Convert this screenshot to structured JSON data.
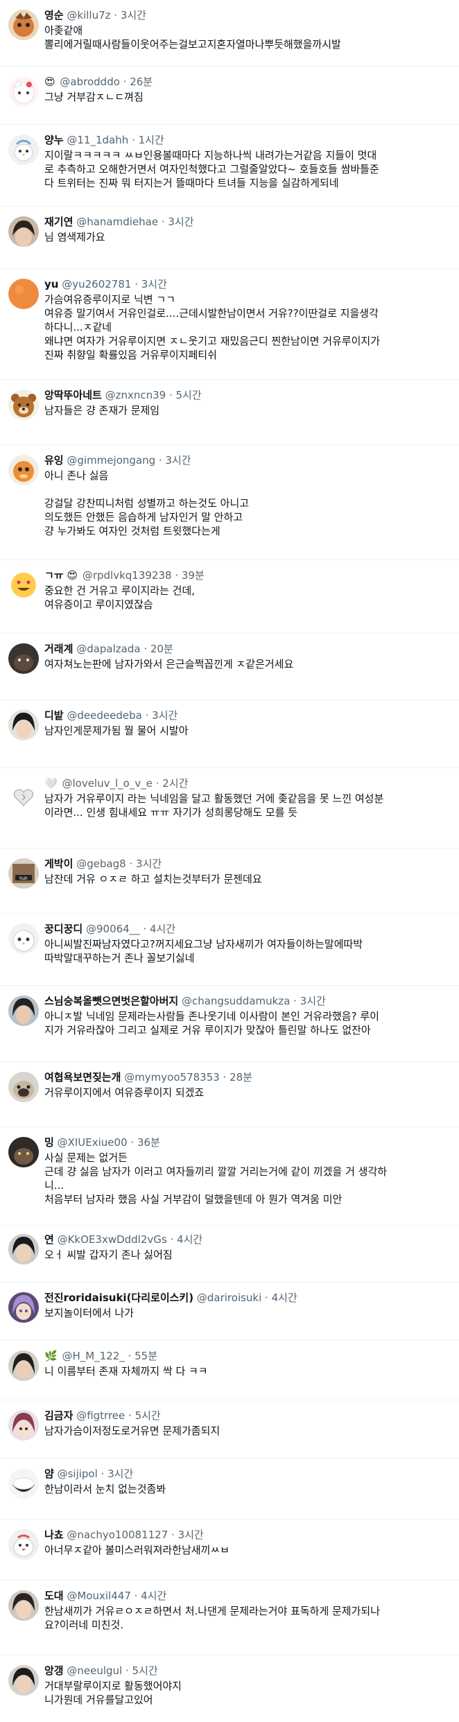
{
  "replies": [
    {
      "name": "영순",
      "handle": "@killu7z",
      "time": "3시간",
      "lines": [
        "아좆같애",
        "뽈리에거릴때사람들이웃어주는걸보고지혼자열마나뿌듯해했을까시발"
      ],
      "avatar": "orange-character"
    },
    {
      "name": "",
      "handle": "@abrodddo",
      "time": "26분",
      "name_emoji": "😍",
      "lines": [
        "그냥 거부감ㅈㄴㄷ껴짐"
      ],
      "avatar": "cat-character"
    },
    {
      "name": "양누",
      "handle": "@11_1dahh",
      "time": "1시간",
      "lines": [
        "지이랄ㅋㅋㅋㅋㅋ ㅆㅂ인용볼때마다 지능하나씩 내려가는거같음 지들이 멋대",
        "로 추측하고 오해한거면서 여자인척했다고 그럴줄알았다~ 호들호들 쌈바틀준",
        "다 트위터는 진짜 뭐 터지는거 뜰때마다 트녀들 지능을 실감하게되네"
      ],
      "avatar": "bird-character"
    },
    {
      "name": "재기연",
      "handle": "@hanamdiehae",
      "time": "3시간",
      "lines": [
        "님 염색제가요"
      ],
      "avatar": "dark-hair-person"
    },
    {
      "name": "yu",
      "handle": "@yu2602781",
      "time": "3시간",
      "lines": [
        "가슴여유증루이지로 닉변 ㄱㄱ",
        "여유증 말기여서 거유인걸로....근데시발한남이면서 거유??이딴걸로 지을생각",
        "하다니...ㅈ같네",
        "왜냐면 여자가 거유루이지면 ㅈㄴ웃기고 재밌음근디 찐한남이면 거유루이지가",
        "진짜 취향일 확률있음 거유루이지페티쉬"
      ],
      "avatar": "orange-circle"
    },
    {
      "name": "앙딱뚜아네트",
      "handle": "@znxncn39",
      "time": "5시간",
      "lines": [
        "남자들은 걍 존재가 문제임"
      ],
      "avatar": "bear-character"
    },
    {
      "name": "유잉",
      "handle": "@gimmejongang",
      "time": "3시간",
      "lines": [
        "아니 존나 싫음",
        "",
        "강걸달 강찬띠니처럼 성별까고 하는것도 아니고",
        "의도했든 안했든 음습하게 남자인거 말 안하고",
        "걍 누가봐도 여자인 것처럼 트윗했다는게"
      ],
      "avatar": "charmander-character"
    },
    {
      "name": "ㄱㅠ",
      "handle": "@rpdlvkq139238",
      "time": "39분",
      "name_emoji": "😍",
      "lines": [
        "중요한 건 거유고 루이지라는 건데,",
        "여유증이고 루이지였잖슴"
      ],
      "avatar": "smile-emoji"
    },
    {
      "name": "거래계",
      "handle": "@dapalzada",
      "time": "20분",
      "lines": [
        "여자쳐노는판에 남자가와서 은근슬쩍꼽낀게 ㅈ같은거세요"
      ],
      "avatar": "dark-animal"
    },
    {
      "name": "디밭",
      "handle": "@deedeedeba",
      "time": "3시간",
      "lines": [
        "남자인게문제가됨 뭘 물어 시발아"
      ],
      "avatar": "dark-hair-person"
    },
    {
      "name": "",
      "handle": "@loveluv_l_o_v_e",
      "time": "2시간",
      "name_emoji": "🤍",
      "lines": [
        "남자가 거유루이지 라는 닉네임을 달고 활동했던 거에 좆같음을 못 느낀 여성분",
        "이라면... 인생 힘내세요 ㅠㅠ 자기가 성희롱당해도 모를 듯"
      ],
      "avatar": "white-heart"
    },
    {
      "name": "게박이",
      "handle": "@gebag8",
      "time": "3시간",
      "lines": [
        "남잔데 거유 ㅇㅈㄹ 하고 설치는것부터가 문젠데요"
      ],
      "avatar": "meme-image"
    },
    {
      "name": "꿍디꿍디",
      "handle": "@90064__",
      "time": "4시간",
      "lines": [
        "아니씨발진짜남자였다고?꺼지세요그냥 남자새끼가 여자들이하는말에따박",
        "따박말대꾸하는거 존나 꼴보기싫네"
      ],
      "avatar": "white-cat"
    },
    {
      "name": "스님숭복올뺏으면벗은할아버지",
      "handle": "@changsuddamukza",
      "time": "3시간",
      "lines": [
        "아니ㅈ발 닉네임 문제라는사람들 존나웃기네 이사람이 본인 거유라했음? 루이",
        "지가 거유라잖아 그리고 실제로 거유 루이지가 맞잖아 틀린말 하나도 없잔아"
      ],
      "avatar": "dark-hair-person"
    },
    {
      "name": "여협욕보면짖는개",
      "handle": "@mymyoo578353",
      "time": "28분",
      "lines": [
        "거유루이지에서 여유증루이지 되겠죠"
      ],
      "avatar": "pug-dog"
    },
    {
      "name": "밍",
      "handle": "@XIUExiue00",
      "time": "36분",
      "lines": [
        "사실 문제는 없거든",
        "근데 걍 싫음 남자가 이러고 여자들끼리 깔깔 거리는거에 같이 끼겠을 거 생각하",
        "니...",
        "처음부터 남자라 했음 사실 거부감이 덜했을텐데 아 뭔가 역겨움 미안"
      ],
      "avatar": "dark-animal"
    },
    {
      "name": "연",
      "handle": "@KkOE3xwDddl2vGs",
      "time": "4시간",
      "lines": [
        "오ㅓ 씨발 갑자기 존나 싫어짐"
      ],
      "avatar": "dark-hair-person"
    },
    {
      "name": "전진roridaisuki(다리로이스키)",
      "handle": "@dariroisuki",
      "time": "4시간",
      "lines": [
        "보지놀이터에서 나가"
      ],
      "avatar": "purple-anime"
    },
    {
      "name": "",
      "handle": "@H_M_122_",
      "time": "55분",
      "name_emoji": "🌿",
      "lines": [
        "니 이름부터 존재 자체까지 싹 다 ㅋㅋ"
      ],
      "avatar": "dark-hair-person"
    },
    {
      "name": "김금자",
      "handle": "@figtrree",
      "time": "5시간",
      "lines": [
        "남자가슴이저정도로거유면 문제가좀되지"
      ],
      "avatar": "anime-girl"
    },
    {
      "name": "얌",
      "handle": "@sijipol",
      "time": "3시간",
      "lines": [
        "한남이라서 눈치 없는것좀봐"
      ],
      "avatar": "rice-bowl"
    },
    {
      "name": "나쵸",
      "handle": "@nachyo10081127",
      "time": "3시간",
      "lines": [
        "아너무ㅈ같아 볼미스러워져라한남새끼ㅆㅂ"
      ],
      "avatar": "bird-character"
    },
    {
      "name": "도대",
      "handle": "@Mouxil447",
      "time": "4시간",
      "lines": [
        "한남새끼가 거유ㄹㅇㅈㄹ하면서 처.나댄게 문제라는거야 표독하게 문제가되나",
        "요?이러네 미친것."
      ],
      "avatar": "dark-hair-person"
    },
    {
      "name": "앙갱",
      "handle": "@neeulgul",
      "time": "5시간",
      "lines": [
        "거대부랄루이지로 활동했어야지",
        "니가뭔데 거유를달고있어"
      ],
      "avatar": "dark-hair-person"
    }
  ]
}
